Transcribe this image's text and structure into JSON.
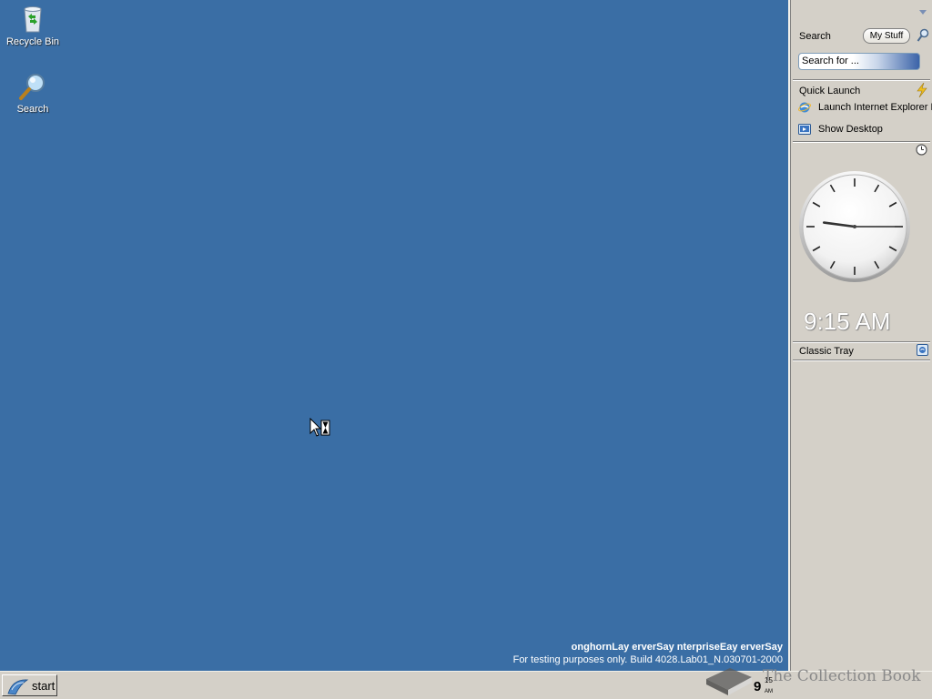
{
  "desktop": {
    "background": "#3A6EA5",
    "icons": [
      {
        "label": "Recycle Bin",
        "icon": "recycle-bin-icon"
      },
      {
        "label": "Search",
        "icon": "search-magnifier-icon"
      }
    ],
    "watermark_line1": "onghornLay erverSay nterpriseEay erverSay",
    "watermark_line2": "For testing purposes only. Build 4028.Lab01_N.030701-2000"
  },
  "sidebar": {
    "search": {
      "title": "Search",
      "my_stuff_label": "My Stuff",
      "input_value": "Search for ..."
    },
    "quick_launch": {
      "title": "Quick Launch",
      "items": [
        {
          "label": "Launch Internet Explorer Browser",
          "icon": "internet-explorer-icon"
        },
        {
          "label": "Show Desktop",
          "icon": "show-desktop-icon"
        }
      ]
    },
    "clock": {
      "digital_time": "9:15 AM",
      "hour": 9,
      "minute": 15
    },
    "classic_tray": {
      "title": "Classic Tray"
    }
  },
  "taskbar": {
    "start_label": "start",
    "tray_hour": "9",
    "tray_minutes": "15",
    "tray_ampm": "AM"
  },
  "overlay": {
    "book_text": "The Collection Book"
  }
}
